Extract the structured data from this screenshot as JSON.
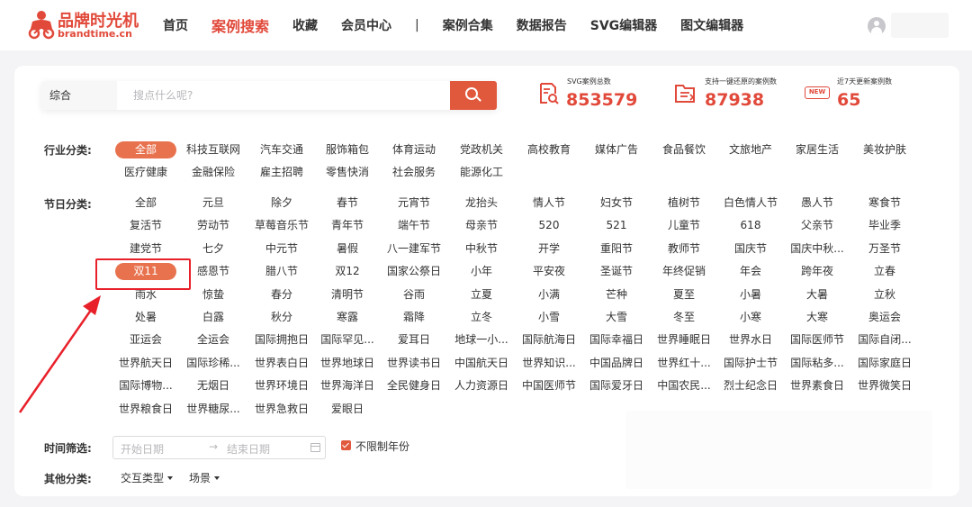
{
  "header": {
    "logo_cn": "品牌时光机",
    "logo_en": "brandtime.cn",
    "nav": [
      {
        "label": "首页",
        "active": false
      },
      {
        "label": "案例搜索",
        "active": true
      },
      {
        "label": "收藏",
        "active": false
      },
      {
        "label": "会员中心",
        "active": false
      },
      {
        "label": "|",
        "separator": true
      },
      {
        "label": "案例合集",
        "active": false
      },
      {
        "label": "数据报告",
        "active": false
      },
      {
        "label": "SVG编辑器",
        "active": false
      },
      {
        "label": "图文编辑器",
        "active": false
      }
    ]
  },
  "search": {
    "type_label": "综合",
    "placeholder": "搜点什么呢?"
  },
  "stats": [
    {
      "label": "SVG案例总数",
      "value": "853579",
      "icon": "document-search-icon"
    },
    {
      "label": "支持一键还原的案例数",
      "value": "87938",
      "icon": "restore-icon"
    },
    {
      "label": "近7天更新案例数",
      "value": "65",
      "icon": "new-badge-icon",
      "badge": "NEW"
    }
  ],
  "industry": {
    "label": "行业分类:",
    "selected": "全部",
    "items": [
      "全部",
      "科技互联网",
      "汽车交通",
      "服饰箱包",
      "体育运动",
      "党政机关",
      "高校教育",
      "媒体广告",
      "食品餐饮",
      "文旅地产",
      "家居生活",
      "美妆护肤",
      "医疗健康",
      "金融保险",
      "雇主招聘",
      "零售快消",
      "社会服务",
      "能源化工"
    ]
  },
  "festival": {
    "label": "节日分类:",
    "selected": "双11",
    "items": [
      "全部",
      "元旦",
      "除夕",
      "春节",
      "元宵节",
      "龙抬头",
      "情人节",
      "妇女节",
      "植树节",
      "白色情人节",
      "愚人节",
      "寒食节",
      "复活节",
      "劳动节",
      "草莓音乐节",
      "青年节",
      "端午节",
      "母亲节",
      "520",
      "521",
      "儿童节",
      "618",
      "父亲节",
      "毕业季",
      "建党节",
      "七夕",
      "中元节",
      "暑假",
      "八一建军节",
      "中秋节",
      "开学",
      "重阳节",
      "教师节",
      "国庆节",
      "国庆中秋...",
      "万圣节",
      "双11",
      "感恩节",
      "腊八节",
      "双12",
      "国家公祭日",
      "小年",
      "平安夜",
      "圣诞节",
      "年终促销",
      "年会",
      "跨年夜",
      "立春",
      "雨水",
      "惊蛰",
      "春分",
      "清明节",
      "谷雨",
      "立夏",
      "小满",
      "芒种",
      "夏至",
      "小暑",
      "大暑",
      "立秋",
      "处暑",
      "白露",
      "秋分",
      "寒露",
      "霜降",
      "立冬",
      "小雪",
      "大雪",
      "冬至",
      "小寒",
      "大寒",
      "奥运会",
      "亚运会",
      "全运会",
      "国际拥抱日",
      "国际罕见...",
      "爱耳日",
      "地球一小...",
      "国际航海日",
      "国际幸福日",
      "世界睡眠日",
      "世界水日",
      "国际医师节",
      "国际自闭...",
      "世界航天日",
      "国际珍稀...",
      "世界表白日",
      "世界地球日",
      "世界读书日",
      "中国航天日",
      "世界知识...",
      "中国品牌日",
      "世界红十...",
      "国际护士节",
      "国际粘多...",
      "国际家庭日",
      "国际博物...",
      "无烟日",
      "世界环境日",
      "世界海洋日",
      "全民健身日",
      "人力资源日",
      "中国医师节",
      "国际爱牙日",
      "中国农民...",
      "烈士纪念日",
      "世界素食日",
      "世界微笑日",
      "世界粮食日",
      "世界糖尿...",
      "世界急救日",
      "爱眼日"
    ]
  },
  "time_filter": {
    "label": "时间筛选:",
    "start_placeholder": "开始日期",
    "separator": "→",
    "end_placeholder": "结束日期",
    "unlimited_year_label": "不限制年份",
    "unlimited_year_checked": true
  },
  "other": {
    "label": "其他分类:",
    "dropdowns": [
      "交互类型",
      "场景"
    ]
  },
  "colors": {
    "accent": "#e1493a",
    "tag_selected": "#e8724e",
    "annotation": "#e8202a"
  }
}
